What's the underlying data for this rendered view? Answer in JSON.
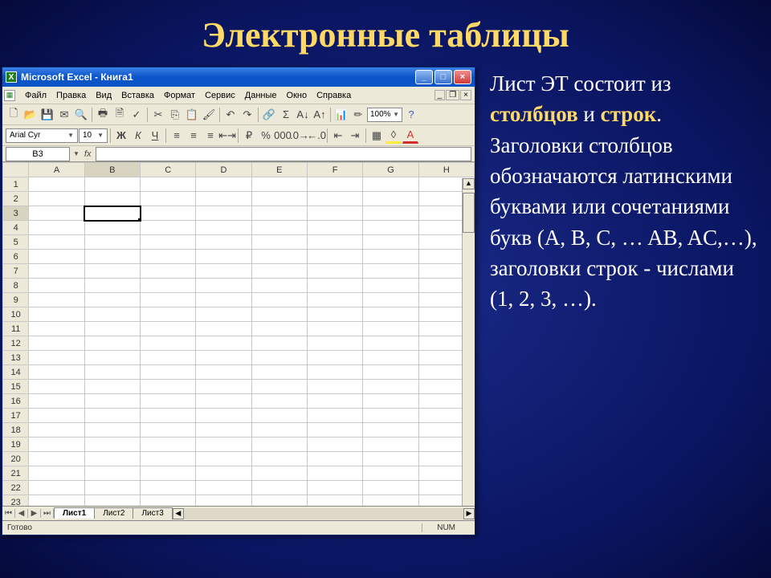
{
  "slide": {
    "title": "Электронные таблицы"
  },
  "side": {
    "t1": "Лист ЭТ состоит из ",
    "em1": "столбцов",
    "t2": " и ",
    "em2": "строк",
    "t3": ". Заголовки столбцов обозначаются латинскими буквами или сочетаниями букв (A, B, C, … AB, AC,…), заголовки строк  -  числами (1, 2, 3, …)."
  },
  "excel": {
    "title": "Microsoft Excel - Книга1",
    "menu": [
      "Файл",
      "Правка",
      "Вид",
      "Вставка",
      "Формат",
      "Сервис",
      "Данные",
      "Окно",
      "Справка"
    ],
    "font": "Arial Cyr",
    "fontsize": "10",
    "zoom": "100%",
    "namebox": "B3",
    "fx": "fx",
    "cols": [
      "A",
      "B",
      "C",
      "D",
      "E",
      "F",
      "G",
      "H"
    ],
    "rowcount": 23,
    "sel": {
      "row": 3,
      "col": "B"
    },
    "tabs": [
      "Лист1",
      "Лист2",
      "Лист3"
    ],
    "active_tab": 0,
    "status": "Готово",
    "caps": "NUM"
  }
}
